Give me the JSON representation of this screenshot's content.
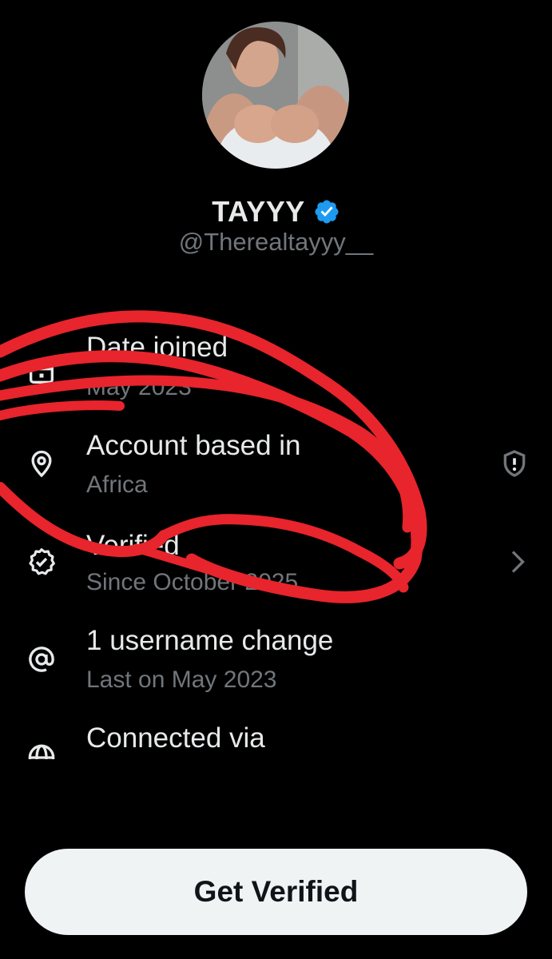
{
  "profile": {
    "display_name": "TAYYY",
    "handle": "@Therealtayyy__",
    "verified_badge_color": "#1d9bf0",
    "avatar_icon": "profile-photo"
  },
  "about": {
    "items": [
      {
        "key": "date_joined",
        "icon": "calendar-icon",
        "title": "Date joined",
        "subtitle": "May 2023"
      },
      {
        "key": "account_based_in",
        "icon": "location-pin-icon",
        "title": "Account based in",
        "subtitle": "Africa",
        "trailing_icon": "shield-alert-icon"
      },
      {
        "key": "verified",
        "icon": "verified-seal-icon",
        "title": "Verified",
        "subtitle": "Since October 2025",
        "trailing_icon": "chevron-right-icon"
      },
      {
        "key": "username_changes",
        "icon": "at-sign-icon",
        "title": "1 username change",
        "subtitle": "Last on May 2023"
      },
      {
        "key": "connected_via",
        "icon": "globe-icon",
        "title": "Connected via"
      }
    ]
  },
  "cta": {
    "label": "Get Verified"
  },
  "colors": {
    "background": "#000000",
    "primary_text": "#e7e9ea",
    "secondary_text": "#71767b",
    "button_bg": "#eff3f4",
    "button_text": "#0f1419",
    "scribble": "#e8242c"
  }
}
